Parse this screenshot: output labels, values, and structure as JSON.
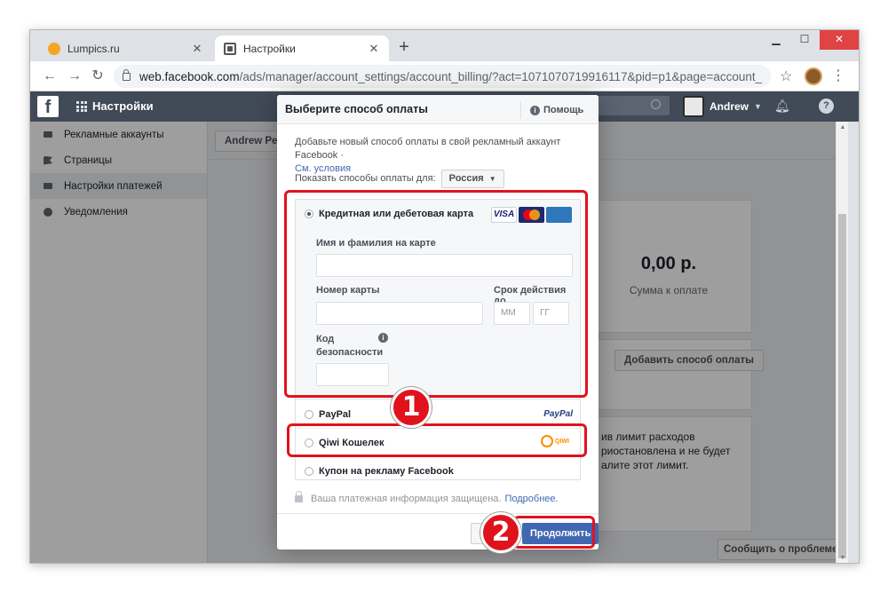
{
  "browser": {
    "tabs": [
      {
        "label": "Lumpics.ru",
        "active": false
      },
      {
        "label": "Настройки",
        "active": true
      }
    ],
    "new_tab_label": "+",
    "window_controls": {
      "minimize": "▁",
      "maximize": "☐",
      "close": "✕"
    },
    "url_host": "web.facebook.com",
    "url_path": "/ads/manager/account_settings/account_billing/?act=1071070719916117&pid=p1&page=account_settings&tab=accou…"
  },
  "fb_header": {
    "logo": "f",
    "title": "Настройки",
    "user_name": "Andrew",
    "help": "?"
  },
  "sidebar": {
    "items": [
      {
        "label": "Рекламные аккаунты",
        "icon": "ad-accounts-icon",
        "active": false
      },
      {
        "label": "Страницы",
        "icon": "flag-icon",
        "active": false
      },
      {
        "label": "Настройки платежей",
        "icon": "card-icon",
        "active": true
      },
      {
        "label": "Уведомления",
        "icon": "globe-icon",
        "active": false
      }
    ]
  },
  "main": {
    "account_button": "Andrew Petro",
    "amount_value": "0,00 р.",
    "amount_label": "Сумма к оплате",
    "add_payment_button": "Добавить способ оплаты",
    "limit_text": "ив лимит расходов\nриостановлена и не будет\nалите этот лимит.",
    "report_button": "Сообщить о проблеме"
  },
  "dialog": {
    "title": "Выберите способ оплаты",
    "help_label": "Помощь",
    "intro_text": "Добавьте новый способ оплаты в свой рекламный аккаунт Facebook ·",
    "terms_link": "См. условия",
    "country_label": "Показать способы оплаты для:",
    "country_value": "Россия",
    "card_option": {
      "label": "Кредитная или дебетовая карта",
      "logos": [
        "VISA",
        "MasterCard",
        "AMERICAN EXPRESS"
      ],
      "name_label": "Имя и фамилия на карте",
      "name_value": "",
      "number_label": "Номер карты",
      "number_value": "",
      "expiry_label": "Срок действия до",
      "month_placeholder": "ММ",
      "year_placeholder": "ГГ",
      "cvv_label": "Код безопасности",
      "cvv_value": ""
    },
    "options": [
      {
        "label": "PayPal",
        "logo": "PayPal"
      },
      {
        "label": "Qiwi Кошелек",
        "logo": "QIWI"
      },
      {
        "label": "Купон на рекламу Facebook",
        "logo": ""
      }
    ],
    "secure_text": "Ваша платежная информация защищена.",
    "secure_link": "Подробнее.",
    "continue_button": "Продолжить"
  },
  "annotations": {
    "badge_1": "1",
    "badge_2": "2",
    "highlight_color": "#e0131d"
  },
  "colors": {
    "fb_header": "#414a57",
    "primary_button": "#4267b2",
    "link": "#4267b2"
  }
}
